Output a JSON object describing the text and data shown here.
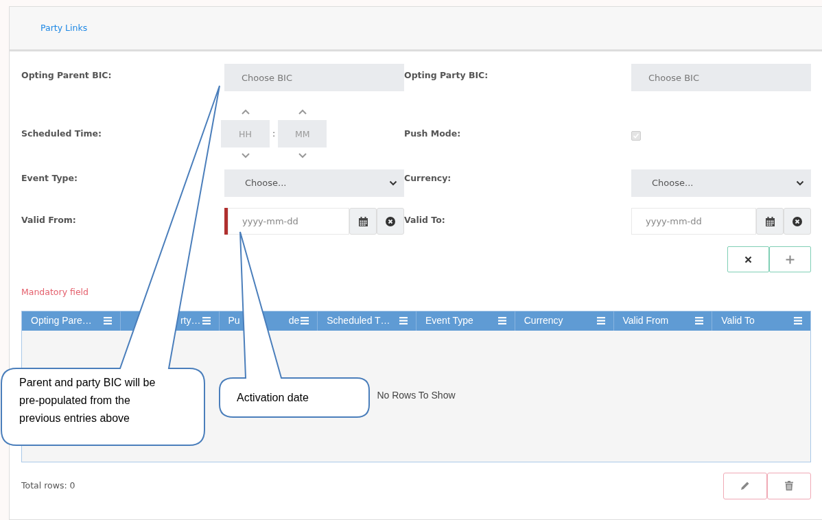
{
  "header": {
    "title": "Party Links"
  },
  "rows": [
    {
      "left": {
        "kind": "bic",
        "label": "Opting Parent BIC:",
        "placeholder": "Choose BIC"
      },
      "right": {
        "kind": "bic",
        "label": "Opting Party BIC:",
        "placeholder": "Choose BIC"
      }
    },
    {
      "left": {
        "kind": "time",
        "label": "Scheduled Time:",
        "hours_placeholder": "HH",
        "separator": ":",
        "minutes_placeholder": "MM"
      },
      "right": {
        "kind": "checkbox",
        "label": "Push Mode:",
        "checked": true,
        "disabled": true
      }
    },
    {
      "left": {
        "kind": "select",
        "label": "Event Type:",
        "value": "Choose..."
      },
      "right": {
        "kind": "select",
        "label": "Currency:",
        "value": "Choose..."
      }
    },
    {
      "left": {
        "kind": "date",
        "label": "Valid From:",
        "placeholder": "yyyy-mm-dd",
        "mandatory": true
      },
      "right": {
        "kind": "date",
        "label": "Valid To:",
        "placeholder": "yyyy-mm-dd",
        "mandatory": false
      }
    }
  ],
  "mandatory_note": "Mandatory field",
  "table": {
    "columns": [
      {
        "fragments": [
          "Opting Pare…"
        ],
        "partly_covered": false
      },
      {
        "fragments": [
          "rty…"
        ],
        "partly_covered": true
      },
      {
        "fragments": [
          "Pu",
          "de"
        ],
        "partly_covered": true
      },
      {
        "fragments": [
          "Scheduled T…"
        ],
        "partly_covered": false
      },
      {
        "fragments": [
          "Event Type"
        ],
        "partly_covered": false
      },
      {
        "fragments": [
          "Currency"
        ],
        "partly_covered": false
      },
      {
        "fragments": [
          "Valid From"
        ],
        "partly_covered": false
      },
      {
        "fragments": [
          "Valid To"
        ],
        "partly_covered": false
      }
    ],
    "empty_message": "No Rows To Show"
  },
  "total_rows": "Total rows: 0",
  "callouts": [
    {
      "text": "Parent and party BIC will be pre-populated from the previous entries above"
    },
    {
      "text": "Activation date"
    }
  ]
}
